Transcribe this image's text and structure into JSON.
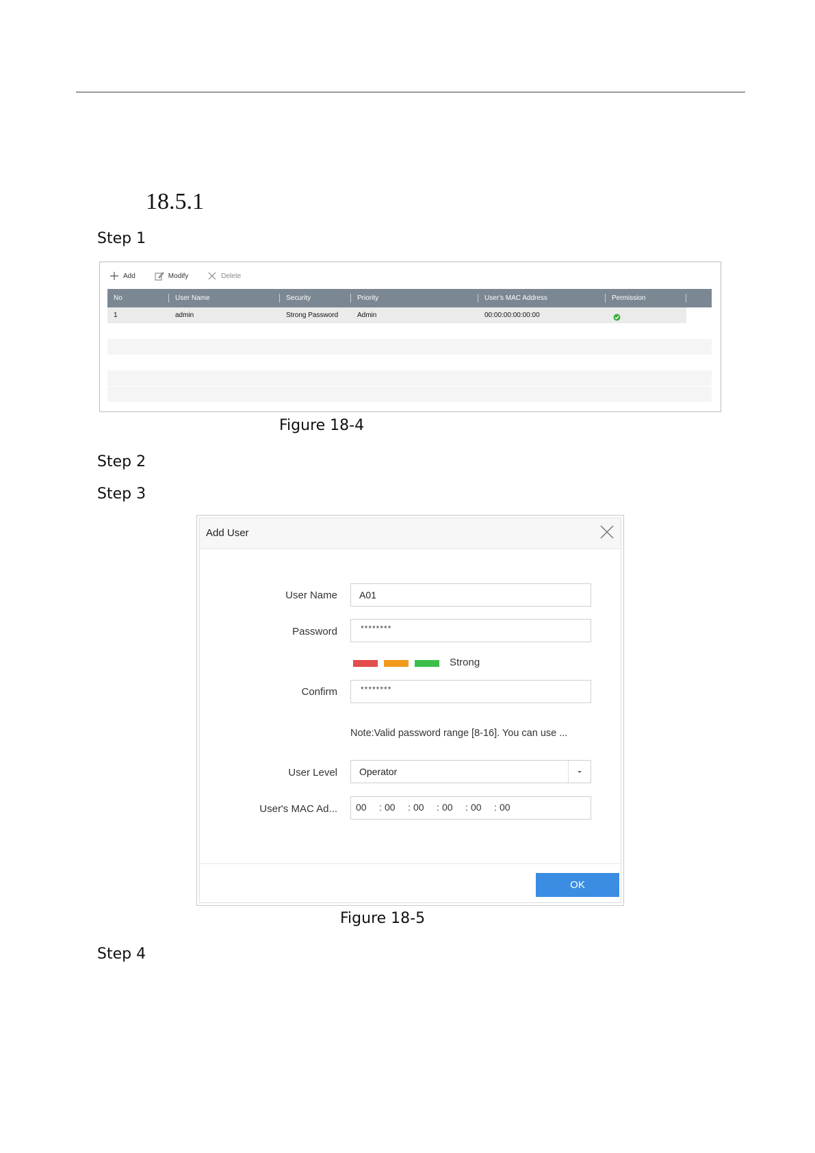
{
  "section_number": "18.5.1",
  "steps": [
    "Step 1",
    "Step 2",
    "Step 3",
    "Step 4"
  ],
  "figure1": {
    "caption": "Figure 18-4",
    "toolbar": {
      "add": "Add",
      "modify": "Modify",
      "delete": "Delete"
    },
    "columns": [
      "No",
      "User Name",
      "Security",
      "Priority",
      "User's MAC Address",
      "Permission"
    ],
    "rows": [
      {
        "no": "1",
        "user_name": "admin",
        "security": "Strong Password",
        "priority": "Admin",
        "mac": "00:00:00:00:00:00",
        "permission_icon": "check-circle-icon"
      }
    ]
  },
  "figure2": {
    "caption": "Figure 18-5",
    "title": "Add User",
    "labels": {
      "user_name": "User Name",
      "password": "Password",
      "confirm": "Confirm",
      "user_level": "User Level",
      "mac": "User's MAC Ad..."
    },
    "values": {
      "user_name": "A01",
      "password": "********",
      "confirm": "********",
      "user_level": "Operator"
    },
    "strength": {
      "label": "Strong",
      "colors": [
        "#e34d4d",
        "#f29a1c",
        "#3cbf4a"
      ]
    },
    "note": "Note:Valid password range [8-16]. You can use ...",
    "mac_segments": [
      "00",
      "00",
      "00",
      "00",
      "00",
      "00"
    ],
    "ok_label": "OK",
    "accent": "#3b8de3"
  }
}
